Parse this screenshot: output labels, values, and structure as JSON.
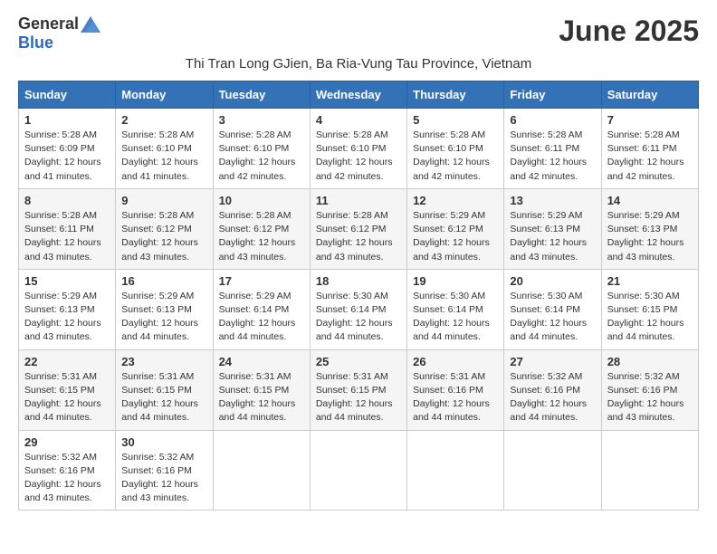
{
  "header": {
    "logo_general": "General",
    "logo_blue": "Blue",
    "title": "June 2025",
    "subtitle": "Thi Tran Long GJien, Ba Ria-Vung Tau Province, Vietnam"
  },
  "weekdays": [
    "Sunday",
    "Monday",
    "Tuesday",
    "Wednesday",
    "Thursday",
    "Friday",
    "Saturday"
  ],
  "weeks": [
    [
      {
        "day": "1",
        "sunrise": "5:28 AM",
        "sunset": "6:09 PM",
        "daylight": "12 hours and 41 minutes."
      },
      {
        "day": "2",
        "sunrise": "5:28 AM",
        "sunset": "6:10 PM",
        "daylight": "12 hours and 41 minutes."
      },
      {
        "day": "3",
        "sunrise": "5:28 AM",
        "sunset": "6:10 PM",
        "daylight": "12 hours and 42 minutes."
      },
      {
        "day": "4",
        "sunrise": "5:28 AM",
        "sunset": "6:10 PM",
        "daylight": "12 hours and 42 minutes."
      },
      {
        "day": "5",
        "sunrise": "5:28 AM",
        "sunset": "6:10 PM",
        "daylight": "12 hours and 42 minutes."
      },
      {
        "day": "6",
        "sunrise": "5:28 AM",
        "sunset": "6:11 PM",
        "daylight": "12 hours and 42 minutes."
      },
      {
        "day": "7",
        "sunrise": "5:28 AM",
        "sunset": "6:11 PM",
        "daylight": "12 hours and 42 minutes."
      }
    ],
    [
      {
        "day": "8",
        "sunrise": "5:28 AM",
        "sunset": "6:11 PM",
        "daylight": "12 hours and 43 minutes."
      },
      {
        "day": "9",
        "sunrise": "5:28 AM",
        "sunset": "6:12 PM",
        "daylight": "12 hours and 43 minutes."
      },
      {
        "day": "10",
        "sunrise": "5:28 AM",
        "sunset": "6:12 PM",
        "daylight": "12 hours and 43 minutes."
      },
      {
        "day": "11",
        "sunrise": "5:28 AM",
        "sunset": "6:12 PM",
        "daylight": "12 hours and 43 minutes."
      },
      {
        "day": "12",
        "sunrise": "5:29 AM",
        "sunset": "6:12 PM",
        "daylight": "12 hours and 43 minutes."
      },
      {
        "day": "13",
        "sunrise": "5:29 AM",
        "sunset": "6:13 PM",
        "daylight": "12 hours and 43 minutes."
      },
      {
        "day": "14",
        "sunrise": "5:29 AM",
        "sunset": "6:13 PM",
        "daylight": "12 hours and 43 minutes."
      }
    ],
    [
      {
        "day": "15",
        "sunrise": "5:29 AM",
        "sunset": "6:13 PM",
        "daylight": "12 hours and 43 minutes."
      },
      {
        "day": "16",
        "sunrise": "5:29 AM",
        "sunset": "6:13 PM",
        "daylight": "12 hours and 44 minutes."
      },
      {
        "day": "17",
        "sunrise": "5:29 AM",
        "sunset": "6:14 PM",
        "daylight": "12 hours and 44 minutes."
      },
      {
        "day": "18",
        "sunrise": "5:30 AM",
        "sunset": "6:14 PM",
        "daylight": "12 hours and 44 minutes."
      },
      {
        "day": "19",
        "sunrise": "5:30 AM",
        "sunset": "6:14 PM",
        "daylight": "12 hours and 44 minutes."
      },
      {
        "day": "20",
        "sunrise": "5:30 AM",
        "sunset": "6:14 PM",
        "daylight": "12 hours and 44 minutes."
      },
      {
        "day": "21",
        "sunrise": "5:30 AM",
        "sunset": "6:15 PM",
        "daylight": "12 hours and 44 minutes."
      }
    ],
    [
      {
        "day": "22",
        "sunrise": "5:31 AM",
        "sunset": "6:15 PM",
        "daylight": "12 hours and 44 minutes."
      },
      {
        "day": "23",
        "sunrise": "5:31 AM",
        "sunset": "6:15 PM",
        "daylight": "12 hours and 44 minutes."
      },
      {
        "day": "24",
        "sunrise": "5:31 AM",
        "sunset": "6:15 PM",
        "daylight": "12 hours and 44 minutes."
      },
      {
        "day": "25",
        "sunrise": "5:31 AM",
        "sunset": "6:15 PM",
        "daylight": "12 hours and 44 minutes."
      },
      {
        "day": "26",
        "sunrise": "5:31 AM",
        "sunset": "6:16 PM",
        "daylight": "12 hours and 44 minutes."
      },
      {
        "day": "27",
        "sunrise": "5:32 AM",
        "sunset": "6:16 PM",
        "daylight": "12 hours and 44 minutes."
      },
      {
        "day": "28",
        "sunrise": "5:32 AM",
        "sunset": "6:16 PM",
        "daylight": "12 hours and 43 minutes."
      }
    ],
    [
      {
        "day": "29",
        "sunrise": "5:32 AM",
        "sunset": "6:16 PM",
        "daylight": "12 hours and 43 minutes."
      },
      {
        "day": "30",
        "sunrise": "5:32 AM",
        "sunset": "6:16 PM",
        "daylight": "12 hours and 43 minutes."
      },
      null,
      null,
      null,
      null,
      null
    ]
  ]
}
